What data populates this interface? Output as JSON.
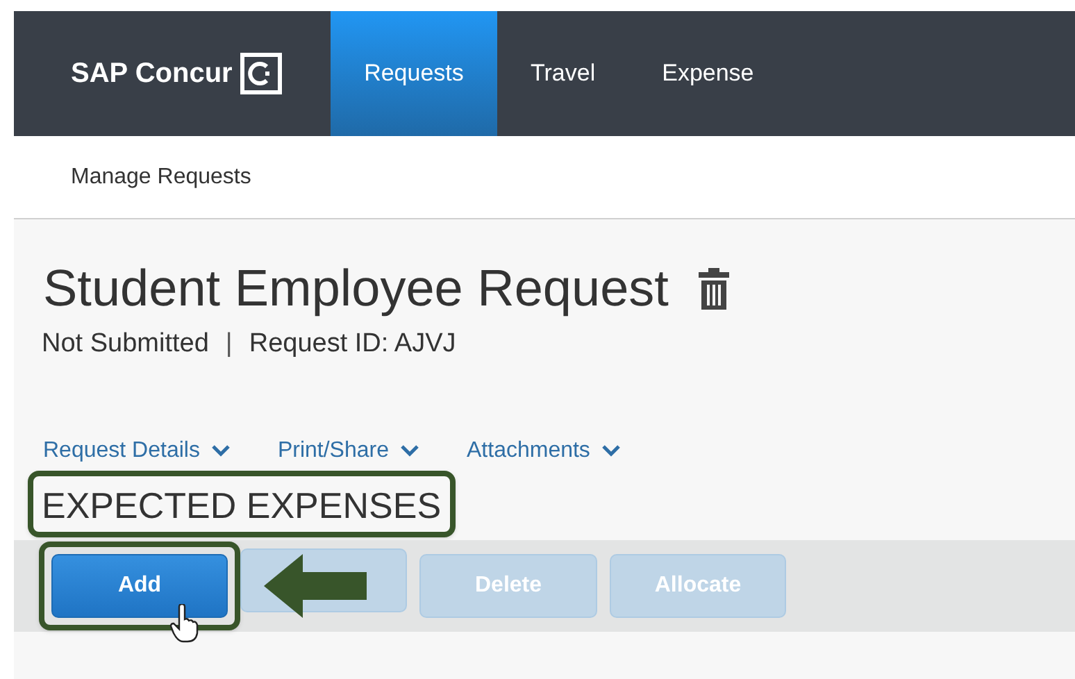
{
  "brand": "SAP Concur",
  "nav": [
    {
      "label": "Requests",
      "selected": true
    },
    {
      "label": "Travel",
      "selected": false
    },
    {
      "label": "Expense",
      "selected": false
    }
  ],
  "subnav": "Manage Requests",
  "title": "Student Employee Request",
  "status": "Not Submitted",
  "separator": "|",
  "request_id": "Request ID: AJVJ",
  "menus": [
    "Request Details",
    "Print/Share",
    "Attachments"
  ],
  "section": "EXPECTED EXPENSES",
  "buttons": [
    {
      "label": "Add",
      "disabled": false
    },
    {
      "disabled": true
    },
    {
      "label": "Delete",
      "disabled": true
    },
    {
      "label": "Allocate",
      "disabled": true
    }
  ]
}
